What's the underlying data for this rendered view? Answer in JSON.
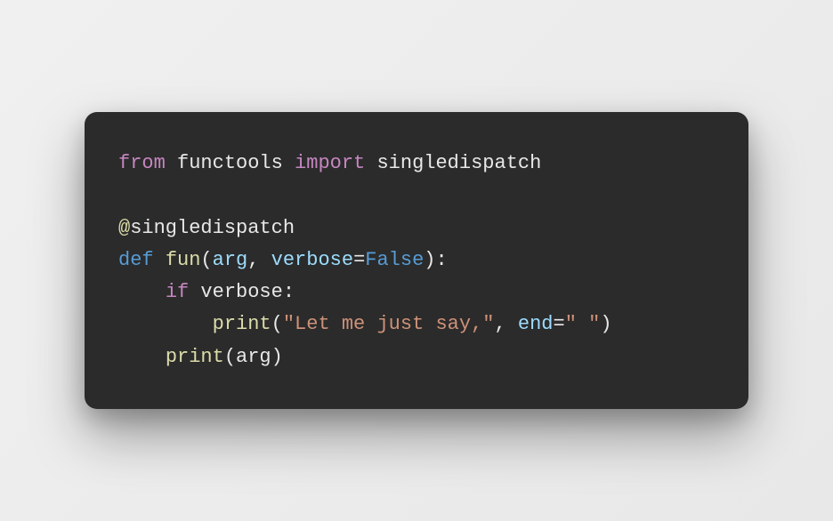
{
  "code": {
    "line1": {
      "from": "from",
      "module": "functools",
      "import": "import",
      "name": "singledispatch"
    },
    "line3": {
      "at": "@",
      "decorator": "singledispatch"
    },
    "line4": {
      "def": "def",
      "func": "fun",
      "lparen": "(",
      "arg1": "arg",
      "comma": ", ",
      "arg2": "verbose",
      "eq": "=",
      "false": "False",
      "rparen": ")",
      "colon": ":"
    },
    "line5": {
      "indent": "    ",
      "if": "if",
      "var": "verbose",
      "colon": ":"
    },
    "line6": {
      "indent": "        ",
      "print": "print",
      "lparen": "(",
      "str": "\"Let me just say,\"",
      "comma": ", ",
      "kwarg": "end",
      "eq": "=",
      "str2": "\" \"",
      "rparen": ")"
    },
    "line7": {
      "indent": "    ",
      "print": "print",
      "lparen": "(",
      "arg": "arg",
      "rparen": ")"
    }
  }
}
